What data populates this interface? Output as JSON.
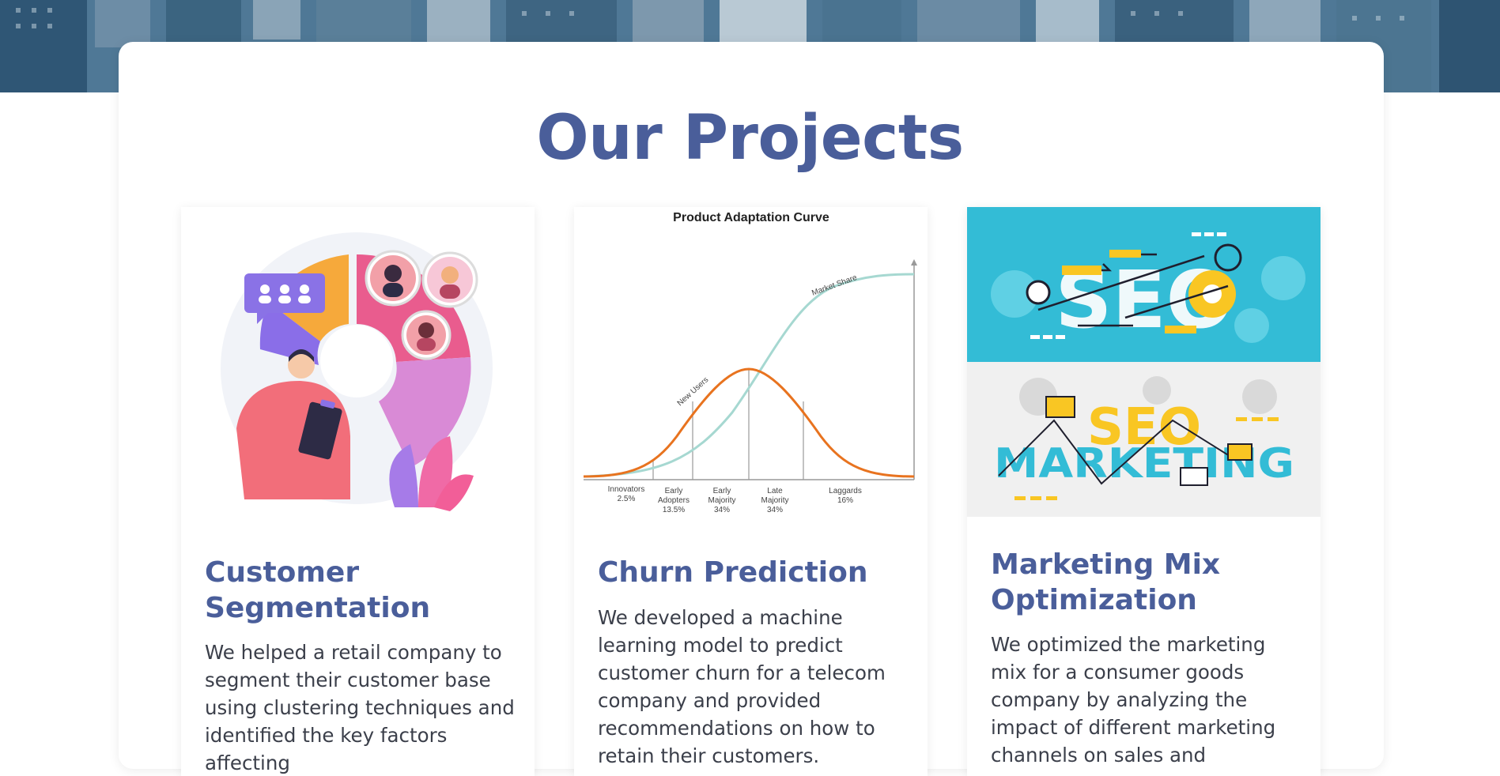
{
  "section": {
    "title": "Our Projects"
  },
  "projects": [
    {
      "title": "Customer Segmentation",
      "description": "We helped a retail company to segment their customer base using clustering techniques and identified the key factors affecting",
      "image": "customer-segmentation-illustration"
    },
    {
      "title": "Churn Prediction",
      "description": "We developed a machine learning model to predict customer churn for a telecom company and provided recommendations on how to retain their customers.",
      "image": "product-adaptation-curve-chart"
    },
    {
      "title": "Marketing Mix Optimization",
      "description": "We optimized the marketing mix for a consumer goods company by analyzing the impact of different marketing channels on sales and",
      "image": "seo-marketing-illustration"
    }
  ],
  "adoption_chart": {
    "title": "Product Adaptation Curve",
    "market_share_label": "Market Share",
    "new_users_label": "New Users",
    "segments": [
      {
        "name": "Innovators",
        "pct": "2.5%"
      },
      {
        "name": "Early Adopters",
        "pct": "13.5%"
      },
      {
        "name": "Early Majority",
        "pct": "34%"
      },
      {
        "name": "Late Majority",
        "pct": "34%"
      },
      {
        "name": "Laggards",
        "pct": "16%"
      }
    ]
  },
  "seo_image": {
    "top_word": "SEO",
    "bottom_word_1": "SEO",
    "bottom_word_2": "MARKETING"
  },
  "colors": {
    "heading": "#4a5e9a",
    "text": "#3b3f4a",
    "seo_blue": "#33bcd6",
    "seo_yellow": "#f9c623",
    "curve_orange": "#e8731f",
    "curve_teal": "#a6d8d1"
  }
}
